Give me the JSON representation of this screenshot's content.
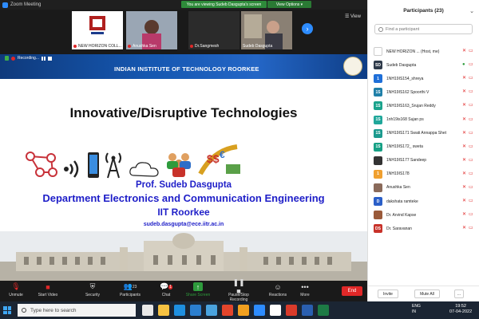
{
  "window": {
    "title": "Zoom Meeting"
  },
  "banner": {
    "viewing": "You are viewing Sudeb Dasgupta's screen",
    "view_options": "View Options ▾"
  },
  "gallery": {
    "tiles": [
      {
        "name": "NEW HORIZON COLL..."
      },
      {
        "name": "Anushka Sen"
      },
      {
        "name": "Dr.Sangmesh"
      },
      {
        "name": "Sudeb Dasgupta"
      }
    ],
    "view_label": "View"
  },
  "slide": {
    "controls": {
      "recording": "Recording..."
    },
    "institute": "INDIAN INSTITUTE OF TECHNOLOGY ROORKEE",
    "title": "Innovative/Disruptive Technologies",
    "presenter": "Prof. Sudeb Dasgupta",
    "department": "Department Electronics and Communication Engineering",
    "institution": "IIT Roorkee",
    "email": "sudeb.dasgupta@ece.iitr.ac.in"
  },
  "toolbar": {
    "unmute": "Unmute",
    "start_video": "Start Video",
    "security": "Security",
    "participants": "Participants",
    "participants_count": "23",
    "chat": "Chat",
    "chat_badge": "1",
    "share": "Share Screen",
    "record": "Pause/Stop Recording",
    "reactions": "Reactions",
    "more": "More",
    "end": "End"
  },
  "participants": {
    "title": "Participants (23)",
    "search_placeholder": "Find a participant",
    "list": [
      {
        "initials": "",
        "name": "NEW HORIZON ... (Host, me)",
        "color": "#ffffff",
        "mic": "muted",
        "cam": "off"
      },
      {
        "initials": "SD",
        "name": "Sudeb Dasgupta",
        "color": "#2f3b4b",
        "mic": "on",
        "cam": "off"
      },
      {
        "initials": "1",
        "name": "1NH19IS154_shreya",
        "color": "#1f6fd8",
        "mic": "muted",
        "cam": "off"
      },
      {
        "initials": "1S",
        "name": "1NH19IS162 Spoorthi V",
        "color": "#1f7fa8",
        "mic": "muted",
        "cam": "off"
      },
      {
        "initials": "1S",
        "name": "1NH19IS163_Srujan Reddy",
        "color": "#1aa38c",
        "mic": "muted",
        "cam": "off"
      },
      {
        "initials": "1S",
        "name": "1nh19is168 Sujan ps",
        "color": "#20a79a",
        "mic": "muted",
        "cam": "off"
      },
      {
        "initials": "1S",
        "name": "1NH19IS171 Swati Annappa Shet",
        "color": "#1b9a8e",
        "mic": "muted",
        "cam": "off"
      },
      {
        "initials": "1S",
        "name": "1NH19IS172_ sweta",
        "color": "#16a085",
        "mic": "muted",
        "cam": "off"
      },
      {
        "initials": "",
        "name": "1NH19IS177 Sandeep",
        "color": "#333333",
        "mic": "muted",
        "cam": "off"
      },
      {
        "initials": "1",
        "name": "1NH19IS178",
        "color": "#f0a030",
        "mic": "muted",
        "cam": "off"
      },
      {
        "initials": "",
        "name": "Anushka Sen",
        "color": "#8a6a5a",
        "mic": "muted",
        "cam": "off"
      },
      {
        "initials": "D",
        "name": "dakshata ramteke",
        "color": "#2b5fc8",
        "mic": "muted",
        "cam": "off"
      },
      {
        "initials": "",
        "name": "Dr. Arvind Kapse",
        "color": "#9a5a3a",
        "mic": "muted",
        "cam": "off"
      },
      {
        "initials": "DS",
        "name": "Dr. Saravanan",
        "color": "#c8322a",
        "mic": "muted",
        "cam": "off"
      }
    ],
    "invite": "Invite",
    "mute_all": "Mute All",
    "more": "..."
  },
  "taskbar": {
    "search_placeholder": "Type here to search",
    "lang1": "ENG",
    "lang2": "IN",
    "time": "19:52",
    "date": "07-04-2022"
  },
  "colors": {
    "zoom_blue": "#2d8cff",
    "end_red": "#e02828",
    "slide_text_blue": "#1e1ec8",
    "banner_green": "#2e8b3a"
  }
}
